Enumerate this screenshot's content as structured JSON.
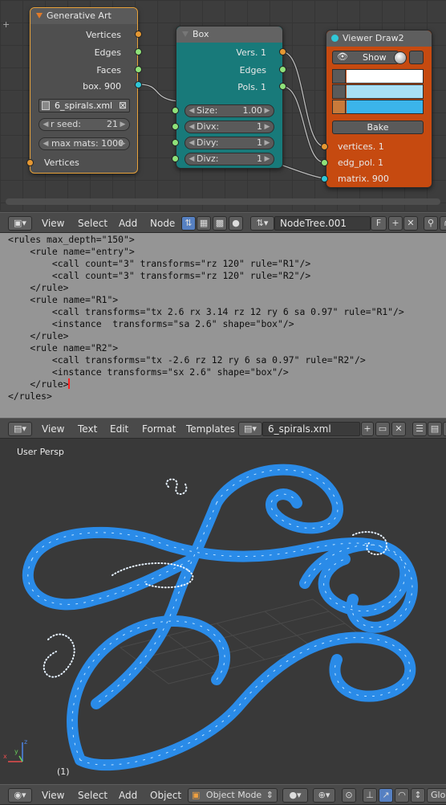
{
  "node_editor": {
    "generative_art": {
      "title": "Generative Art",
      "outputs": [
        "Vertices",
        "Edges",
        "Faces",
        "box. 900"
      ],
      "filename": "6_spirals.xml",
      "rseed_label": "r seed:",
      "rseed_value": "21",
      "max_mats_label": "max mats: 1000",
      "input": "Vertices"
    },
    "box": {
      "title": "Box",
      "outputs": [
        "Vers. 1",
        "Edges",
        "Pols. 1"
      ],
      "size_label": "Size:",
      "size_value": "1.00",
      "divx_label": "Divx:",
      "divx_value": "1",
      "divy_label": "Divy:",
      "divy_value": "1",
      "divz_label": "Divz:",
      "divz_value": "1"
    },
    "viewer": {
      "title": "Viewer Draw2",
      "show_label": "Show",
      "bake_label": "Bake",
      "inputs": [
        "vertices. 1",
        "edg_pol. 1",
        "matrix. 900"
      ],
      "color_swatches": [
        "#ffffff",
        "#a8dff5",
        "#3bb4ea"
      ]
    },
    "colors": {
      "ga_border": "#e8a23a",
      "box_body": "#187a7a",
      "viewer_body": "#c64a10"
    }
  },
  "node_header": {
    "menus": [
      "View",
      "Select",
      "Add",
      "Node"
    ],
    "tree_name": "NodeTree.001",
    "fake_user": "F"
  },
  "text_editor": {
    "lines": [
      "<rules max_depth=\"150\">",
      "    <rule name=\"entry\">",
      "        <call count=\"3\" transforms=\"rz 120\" rule=\"R1\"/>",
      "        <call count=\"3\" transforms=\"rz 120\" rule=\"R2\"/>",
      "    </rule>",
      "    <rule name=\"R1\">",
      "        <call transforms=\"tx 2.6 rx 3.14 rz 12 ry 6 sa 0.97\" rule=\"R1\"/>",
      "        <instance  transforms=\"sa 2.6\" shape=\"box\"/>",
      "    </rule>",
      "    <rule name=\"R2\">",
      "        <call transforms=\"tx -2.6 rz 12 ry 6 sa 0.97\" rule=\"R2\"/>",
      "        <instance transforms=\"sx 2.6\" shape=\"box\"/>",
      "    </rule>",
      "</rules>"
    ]
  },
  "text_header": {
    "menus": [
      "View",
      "Text",
      "Edit",
      "Format",
      "Templates"
    ],
    "file_name": "6_spirals.xml"
  },
  "viewport": {
    "label": "User Persp",
    "frame": "(1)",
    "mesh_color": "#2a8be8"
  },
  "view_header": {
    "menus": [
      "View",
      "Select",
      "Add",
      "Object"
    ],
    "mode": "Object Mode",
    "orientation_partial": "Glo"
  }
}
